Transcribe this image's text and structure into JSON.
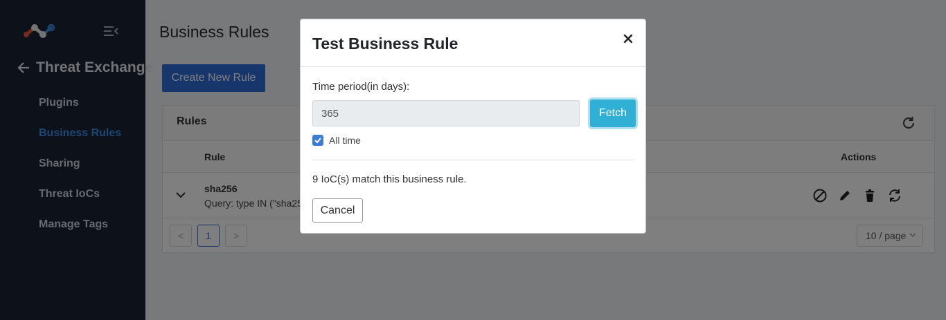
{
  "sidebar": {
    "logo_icon": "network-logo-icon",
    "menu_toggle_icon": "menu-collapse-icon",
    "back_icon": "arrow-left-icon",
    "section_title": "Threat Exchange",
    "items": [
      {
        "label": "Plugins",
        "active": false
      },
      {
        "label": "Business Rules",
        "active": true
      },
      {
        "label": "Sharing",
        "active": false
      },
      {
        "label": "Threat IoCs",
        "active": false
      },
      {
        "label": "Manage Tags",
        "active": false
      }
    ],
    "accent": "#3a8ee6",
    "background": "#1b2232"
  },
  "main": {
    "page_title": "Business Rules",
    "create_button": "Create New Rule",
    "card": {
      "title": "Rules",
      "refresh_icon": "refresh-icon",
      "columns": {
        "rule": "Rule",
        "actions": "Actions"
      },
      "rows": [
        {
          "name": "sha256",
          "query": "Query: type IN (\"sha25"
        }
      ],
      "action_icons": [
        "block-icon",
        "edit-icon",
        "delete-icon",
        "sync-icon"
      ],
      "pagination": {
        "prev": "<",
        "current": "1",
        "next": ">",
        "per_page": "10 / page"
      }
    }
  },
  "modal": {
    "title": "Test Business Rule",
    "close": "×",
    "field_label": "Time period(in days):",
    "time_value": "365",
    "fetch_button": "Fetch",
    "checkbox_label": "All time",
    "checkbox_checked": true,
    "match_text": "9 IoC(s) match this business rule.",
    "cancel_button": "Cancel"
  }
}
